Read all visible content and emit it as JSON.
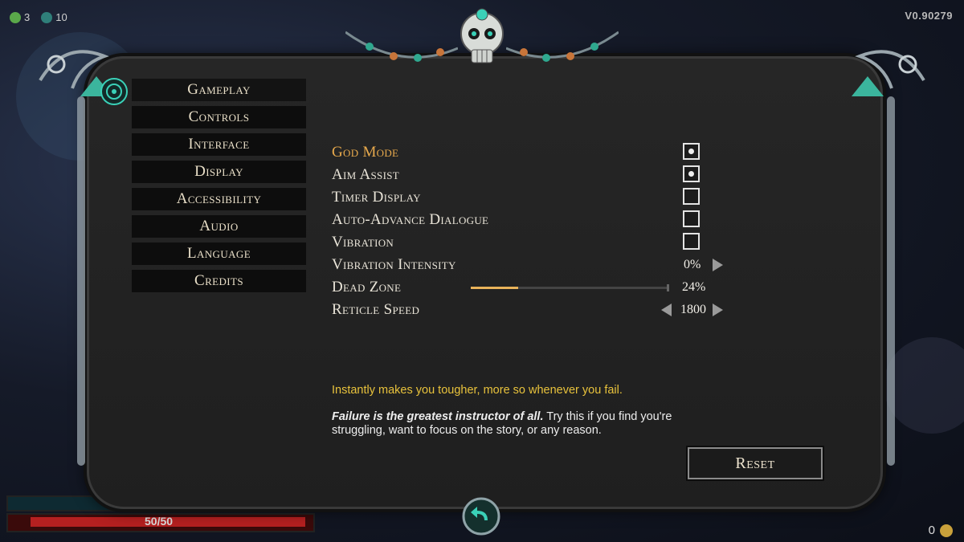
{
  "hud": {
    "counter_1": "3",
    "counter_2": "10",
    "version": "V0.90279",
    "health": "50/50",
    "gold": "0"
  },
  "nav": {
    "items": [
      {
        "label": "Gameplay"
      },
      {
        "label": "Controls"
      },
      {
        "label": "Interface"
      },
      {
        "label": "Display"
      },
      {
        "label": "Accessibility"
      },
      {
        "label": "Audio"
      },
      {
        "label": "Language"
      },
      {
        "label": "Credits"
      }
    ],
    "active_index": 0
  },
  "settings": {
    "god_mode": {
      "label": "God Mode",
      "checked": true
    },
    "aim_assist": {
      "label": "Aim Assist",
      "checked": true
    },
    "timer_display": {
      "label": "Timer Display",
      "checked": false
    },
    "auto_advance": {
      "label": "Auto-Advance Dialogue",
      "checked": false
    },
    "vibration": {
      "label": "Vibration",
      "checked": false
    },
    "vibration_intensity": {
      "label": "Vibration Intensity",
      "value": "0%"
    },
    "dead_zone": {
      "label": "Dead Zone",
      "value": "24%",
      "fraction": 0.24
    },
    "reticle_speed": {
      "label": "Reticle Speed",
      "value": "1800"
    }
  },
  "description": {
    "hint": "Instantly makes you tougher, more so whenever you fail.",
    "lore_bold": "Failure is the greatest instructor of all.",
    "lore_rest": " Try this if you find you're struggling, want to focus on the story, or any reason."
  },
  "buttons": {
    "reset": "Reset"
  },
  "colors": {
    "highlight": "#e7a94c",
    "hint": "#e8c23c",
    "slider_fill": "#e9b35a",
    "teal": "#3ad1b8"
  }
}
